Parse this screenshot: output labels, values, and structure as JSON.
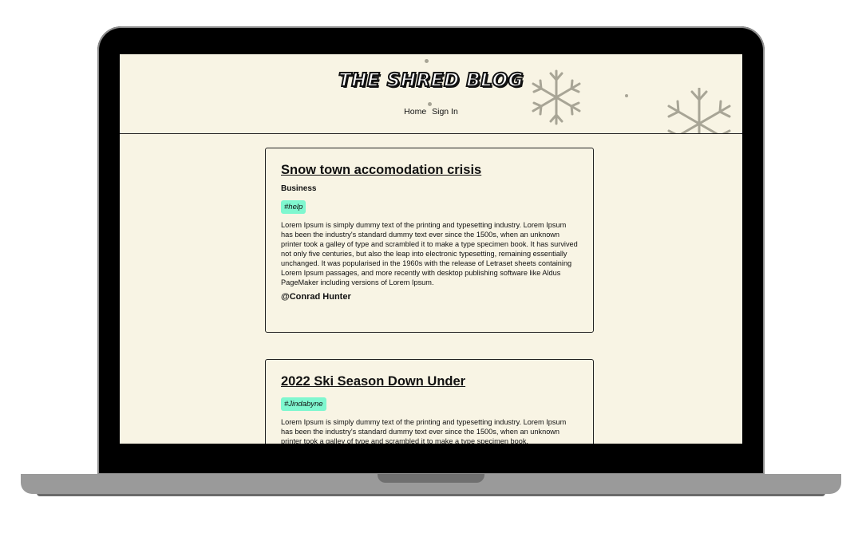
{
  "site": {
    "logo_text": "THE SHRED BLOG",
    "nav": {
      "home": "Home",
      "sign_in": "Sign In"
    }
  },
  "posts": [
    {
      "title": "Snow town accomodation crisis",
      "category": "Business",
      "tag": "#help",
      "body": "Lorem Ipsum is simply dummy text of the printing and typesetting industry. Lorem Ipsum has been the industry's standard dummy text ever since the 1500s, when an unknown printer took a galley of type and scrambled it to make a type specimen book. It has survived not only five centuries, but also the leap into electronic typesetting, remaining essentially unchanged. It was popularised in the 1960s with the release of Letraset sheets containing Lorem Ipsum passages, and more recently with desktop publishing software like Aldus PageMaker including versions of Lorem Ipsum.",
      "author": "@Conrad Hunter"
    },
    {
      "title": "2022 Ski Season Down Under",
      "tag": "#Jindabyne",
      "body": "Lorem Ipsum is simply dummy text of the printing and typesetting industry. Lorem Ipsum has been the industry's standard dummy text ever since the 1500s, when an unknown printer took a galley of type and scrambled it to make a type specimen book."
    }
  ],
  "colors": {
    "page_background": "#f8f4e4",
    "tag_background": "#7ff7cf",
    "snow_decoration": "#a8a596"
  }
}
